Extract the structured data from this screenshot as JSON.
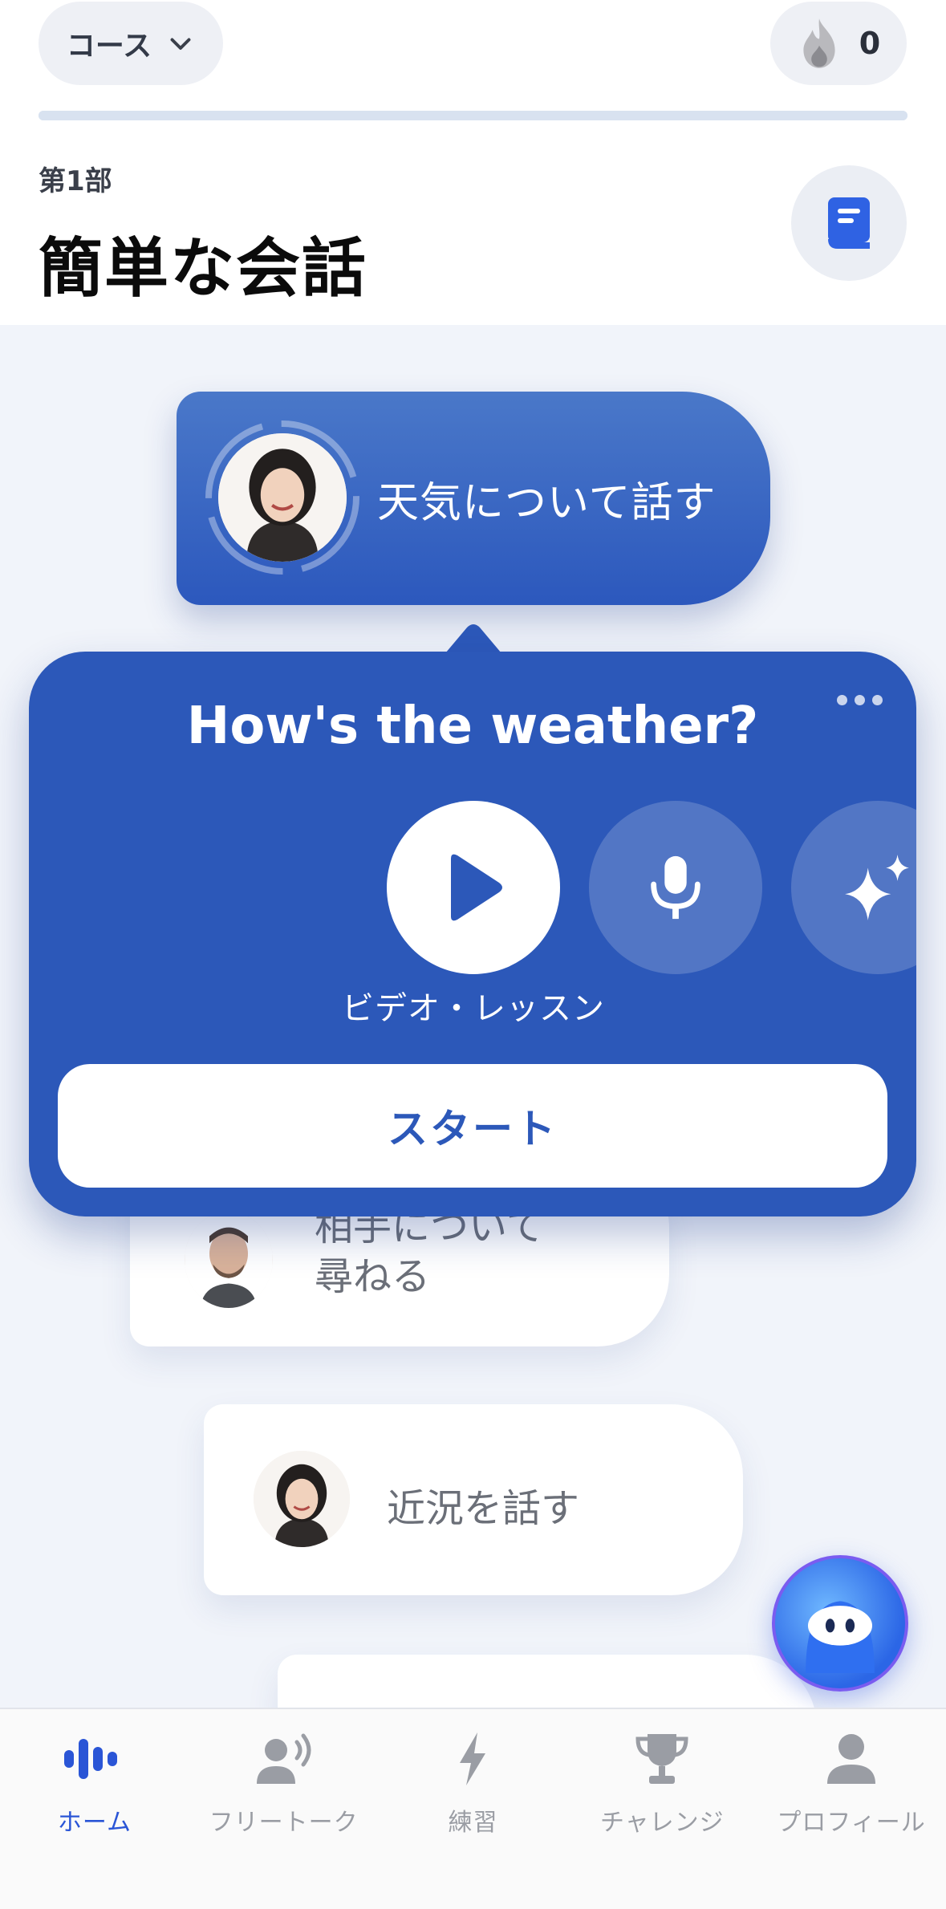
{
  "header": {
    "course_label": "コース",
    "streak_count": "0",
    "progress_fraction": 1.0,
    "part_label": "第1部",
    "title": "簡単な会話"
  },
  "active_lesson": {
    "label": "天気について話す"
  },
  "popup": {
    "title": "How's the weather?",
    "caption": "ビデオ・レッスン",
    "start_label": "スタート"
  },
  "lessons": [
    {
      "label_line1": "相手について",
      "label_line2": "尋ねる"
    },
    {
      "label": "近況を話す"
    }
  ],
  "tabs": [
    {
      "label": "ホーム",
      "icon": "waveform-icon",
      "active": true
    },
    {
      "label": "フリートーク",
      "icon": "speaking-person-icon",
      "active": false
    },
    {
      "label": "練習",
      "icon": "lightning-icon",
      "active": false
    },
    {
      "label": "チャレンジ",
      "icon": "trophy-icon",
      "active": false
    },
    {
      "label": "プロフィール",
      "icon": "person-icon",
      "active": false
    }
  ],
  "colors": {
    "accent": "#2c58b9",
    "tab_active": "#2a55d6",
    "tab_inactive": "#9a9da4"
  }
}
